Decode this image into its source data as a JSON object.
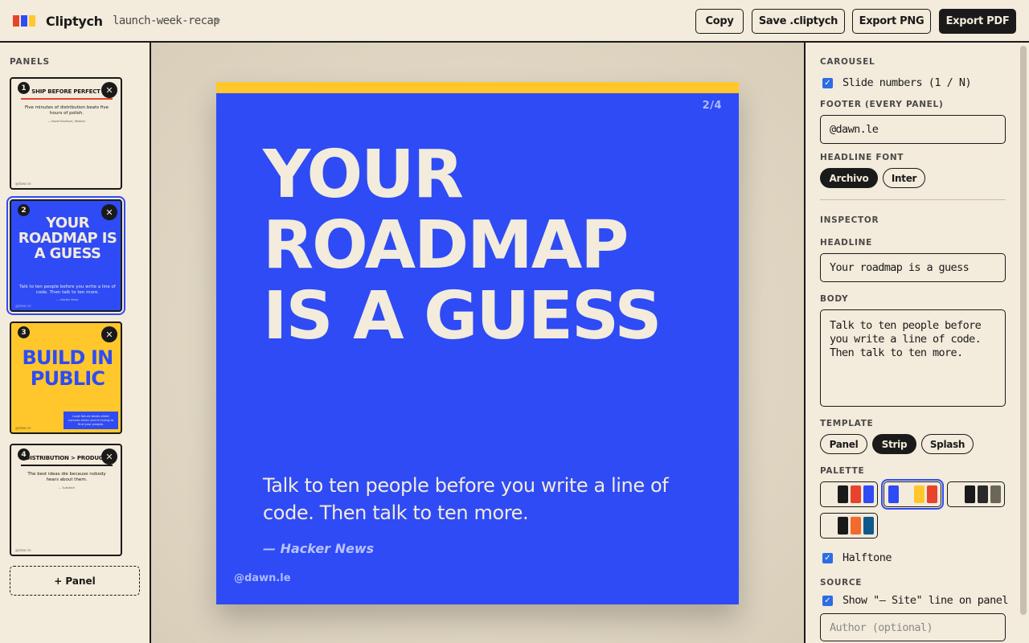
{
  "app": {
    "name": "Cliptych",
    "doc_name": "launch-week-recap",
    "logo_colors": [
      "#e8432d",
      "#2e4bf5",
      "#ffc72c"
    ]
  },
  "toolbar": {
    "copy": "Copy",
    "save": "Save .cliptych",
    "export_png": "Export PNG",
    "export_pdf": "Export PDF"
  },
  "panels": {
    "label": "PANELS",
    "add_label": "+ Panel",
    "items": [
      {
        "num": "1",
        "headline": "SHIP BEFORE PERFECT",
        "body": "Five minutes of distribution beats five hours of polish.",
        "source": "— Naval Ravikant, Medium",
        "handle": "@dawn.le",
        "selected": false
      },
      {
        "num": "2",
        "headline": "YOUR ROADMAP IS A GUESS",
        "body": "Talk to ten people before you write a line of code. Then talk to ten more.",
        "source": "— Hacker News",
        "handle": "@dawn.le",
        "selected": true
      },
      {
        "num": "3",
        "headline": "BUILD IN PUBLIC",
        "body": "Loud failure beats silent success when you're trying to find your people.",
        "source": "",
        "handle": "@dawn.le",
        "selected": false
      },
      {
        "num": "4",
        "headline": "DISTRIBUTION > PRODUCT",
        "body": "The best ideas die because nobody hears about them.",
        "source": "— Substack",
        "handle": "@dawn.le",
        "selected": false
      }
    ]
  },
  "slide": {
    "page": "2/4",
    "headline": "Your roadmap is a guess",
    "body": "Talk to ten people before you write a line of code. Then talk to ten more.",
    "source": "— Hacker News",
    "footer": "@dawn.le",
    "colors": {
      "bg": "#2e4bf5",
      "strip": "#ffc72c",
      "text": "#f3ebdb"
    }
  },
  "inspector": {
    "carousel_label": "CAROUSEL",
    "slide_numbers_label": "Slide numbers (1 / N)",
    "slide_numbers_checked": true,
    "footer_label": "FOOTER (EVERY PANEL)",
    "footer_value": "@dawn.le",
    "headline_font_label": "HEADLINE FONT",
    "fonts": [
      {
        "label": "Archivo",
        "selected": true
      },
      {
        "label": "Inter",
        "selected": false
      }
    ],
    "inspector_label": "INSPECTOR",
    "headline_label": "HEADLINE",
    "headline_value": "Your roadmap is a guess",
    "body_label": "BODY",
    "body_value": "Talk to ten people before you write a line of code. Then talk to ten more.",
    "template_label": "TEMPLATE",
    "templates": [
      {
        "label": "Panel",
        "selected": false
      },
      {
        "label": "Strip",
        "selected": true
      },
      {
        "label": "Splash",
        "selected": false
      }
    ],
    "palette_label": "PALETTE",
    "palettes": [
      {
        "colors": [
          "#f3ebdb",
          "#1a1a1a",
          "#e8432d",
          "#2e4bf5"
        ],
        "selected": false
      },
      {
        "colors": [
          "#2e4bf5",
          "#f3ebdb",
          "#ffc72c",
          "#e8432d"
        ],
        "selected": true
      },
      {
        "colors": [
          "#f3ebdb",
          "#1a1a1a",
          "#2a2a2a",
          "#6b6758"
        ],
        "selected": false
      },
      {
        "colors": [
          "#f3ebdb",
          "#1a1a1a",
          "#f26a2d",
          "#0e5a8a"
        ],
        "selected": false
      }
    ],
    "halftone_label": "Halftone",
    "halftone_checked": true,
    "source_label": "SOURCE",
    "show_source_label": "Show \"— Site\" line on panel",
    "show_source_checked": true,
    "author_placeholder": "Author (optional)"
  }
}
